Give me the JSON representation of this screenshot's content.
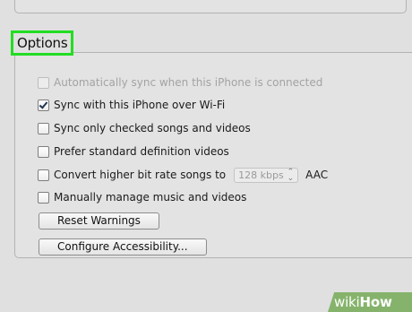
{
  "options": {
    "title": "Options",
    "items": [
      {
        "label": "Automatically sync when this iPhone is connected",
        "checked": false,
        "disabled": true
      },
      {
        "label": "Sync with this iPhone over Wi-Fi",
        "checked": true,
        "disabled": false
      },
      {
        "label": "Sync only checked songs and videos",
        "checked": false,
        "disabled": false
      },
      {
        "label": "Prefer standard definition videos",
        "checked": false,
        "disabled": false
      },
      {
        "label": "Convert higher bit rate songs to",
        "checked": false,
        "disabled": false
      },
      {
        "label": "Manually manage music and videos",
        "checked": false,
        "disabled": false
      }
    ],
    "bitrate": {
      "value": "128 kbps",
      "unit": "AAC"
    },
    "buttons": {
      "reset_warnings": "Reset Warnings",
      "configure_accessibility": "Configure Accessibility..."
    }
  },
  "watermark": {
    "part1": "wiki",
    "part2": "How"
  },
  "colors": {
    "highlight_box": "#22dd22",
    "badge": "#85b36b",
    "checkmark": "#1f3552"
  },
  "icons": [
    "checkmark-icon",
    "chevron-updown-icon"
  ]
}
